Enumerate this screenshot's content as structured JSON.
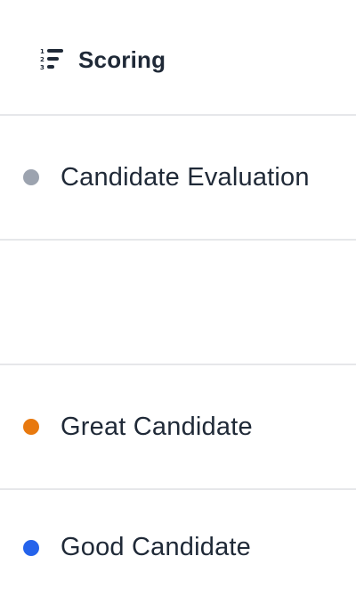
{
  "header": {
    "title": "Scoring",
    "icon": "ordered-list-icon"
  },
  "rows": [
    {
      "label": "Candidate Evaluation",
      "dot_color": "#9ca3af"
    },
    {
      "label": ""
    },
    {
      "label": "Great Candidate",
      "dot_color": "#e8790f"
    },
    {
      "label": "Good Candidate",
      "dot_color": "#2563eb"
    }
  ],
  "colors": {
    "text": "#1f2937",
    "divider": "#e6e7ea",
    "background": "#ffffff"
  }
}
